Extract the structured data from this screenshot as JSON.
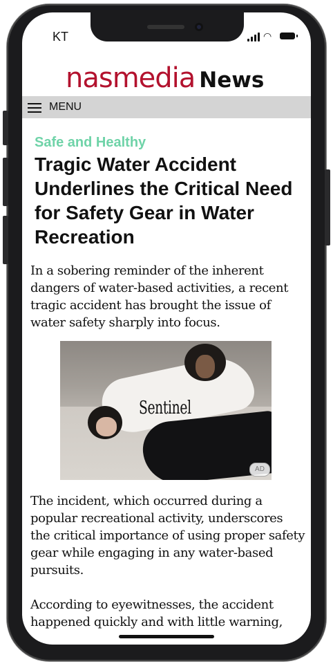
{
  "status_bar": {
    "carrier": "KT",
    "icons": [
      "cellular-signal-icon",
      "wifi-icon",
      "battery-icon"
    ]
  },
  "header": {
    "logo_brand": "nasmedia",
    "logo_suffix": "News",
    "brand_color": "#b3122e"
  },
  "menu": {
    "label": "MENU",
    "icon": "hamburger-icon"
  },
  "article": {
    "category": "Safe and Healthy",
    "category_color": "#6fd3a8",
    "headline": "Tragic Water Accident Underlines the Critical Need for Safety Gear in Water Recreation",
    "paragraphs": [
      "In a sobering reminder of the inherent dangers of water-based activities, a recent tragic accident has brought the issue of water safety sharply into focus.",
      "The incident, which occurred during a popular recreational activity, underscores the critical importance of using proper safety gear while engaging in any water-based pursuits.",
      "According to eyewitnesses, the accident happened quickly and with little warning,"
    ]
  },
  "ad": {
    "brand_text": "Sentinel",
    "badge": "AD"
  }
}
